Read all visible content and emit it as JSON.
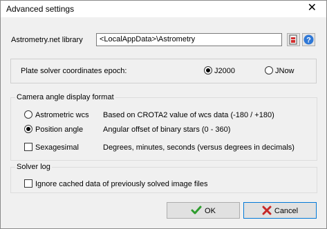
{
  "window": {
    "title": "Advanced settings",
    "close_glyph": "✕"
  },
  "astrometry": {
    "label": "Astrometry.net library",
    "path_value": "<LocalAppData>\\Astrometry"
  },
  "icons": {
    "browse": "folder-open-icon",
    "help": "help-icon"
  },
  "epoch": {
    "label": "Plate solver coordinates epoch:",
    "options": [
      {
        "label": "J2000",
        "checked": true
      },
      {
        "label": "JNow",
        "checked": false
      }
    ]
  },
  "camera": {
    "title": "Camera angle display format",
    "options": [
      {
        "label": "Astrometric wcs",
        "description": "Based on CROTA2 value of wcs data  (-180  / +180)",
        "checked": false
      },
      {
        "label": "Position angle",
        "description": "Angular offset of binary stars  (0 - 360)",
        "checked": true
      }
    ],
    "sexagesimal": {
      "label": "Sexagesimal",
      "description": "Degrees, minutes, seconds   (versus degrees in decimals)",
      "checked": false
    }
  },
  "solver_log": {
    "title": "Solver log",
    "ignore_cached_label": "Ignore cached data of previously solved image files",
    "checked": false
  },
  "buttons": {
    "ok": "OK",
    "cancel": "Cancel"
  },
  "colors": {
    "ok_check": "#2e9d2e",
    "cancel_x": "#c62828",
    "default_border": "#0078d7"
  }
}
